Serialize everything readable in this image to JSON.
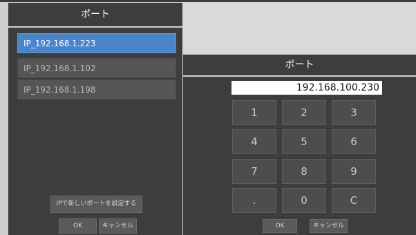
{
  "left_dialog": {
    "title": "ポート",
    "ports": [
      {
        "label": "IP_192.168.1.223",
        "selected": true
      },
      {
        "label": "IP_192.168.1.102",
        "selected": false
      },
      {
        "label": "IP_192.168.1.198",
        "selected": false
      }
    ],
    "new_port_button": "IPで新しいポートを設定する",
    "ok_button": "OK",
    "cancel_button": "キャンセル"
  },
  "keypad_dialog": {
    "title": "ポート",
    "ip_value": "192.168.100.230",
    "keys": [
      "1",
      "2",
      "3",
      "4",
      "5",
      "6",
      "7",
      "8",
      "9",
      ".",
      "0",
      "C"
    ],
    "ok_button": "OK",
    "cancel_button": "キャンセル"
  },
  "colors": {
    "selected_item": "#4a84c9",
    "dialog_bg": "#3d3d3d"
  }
}
